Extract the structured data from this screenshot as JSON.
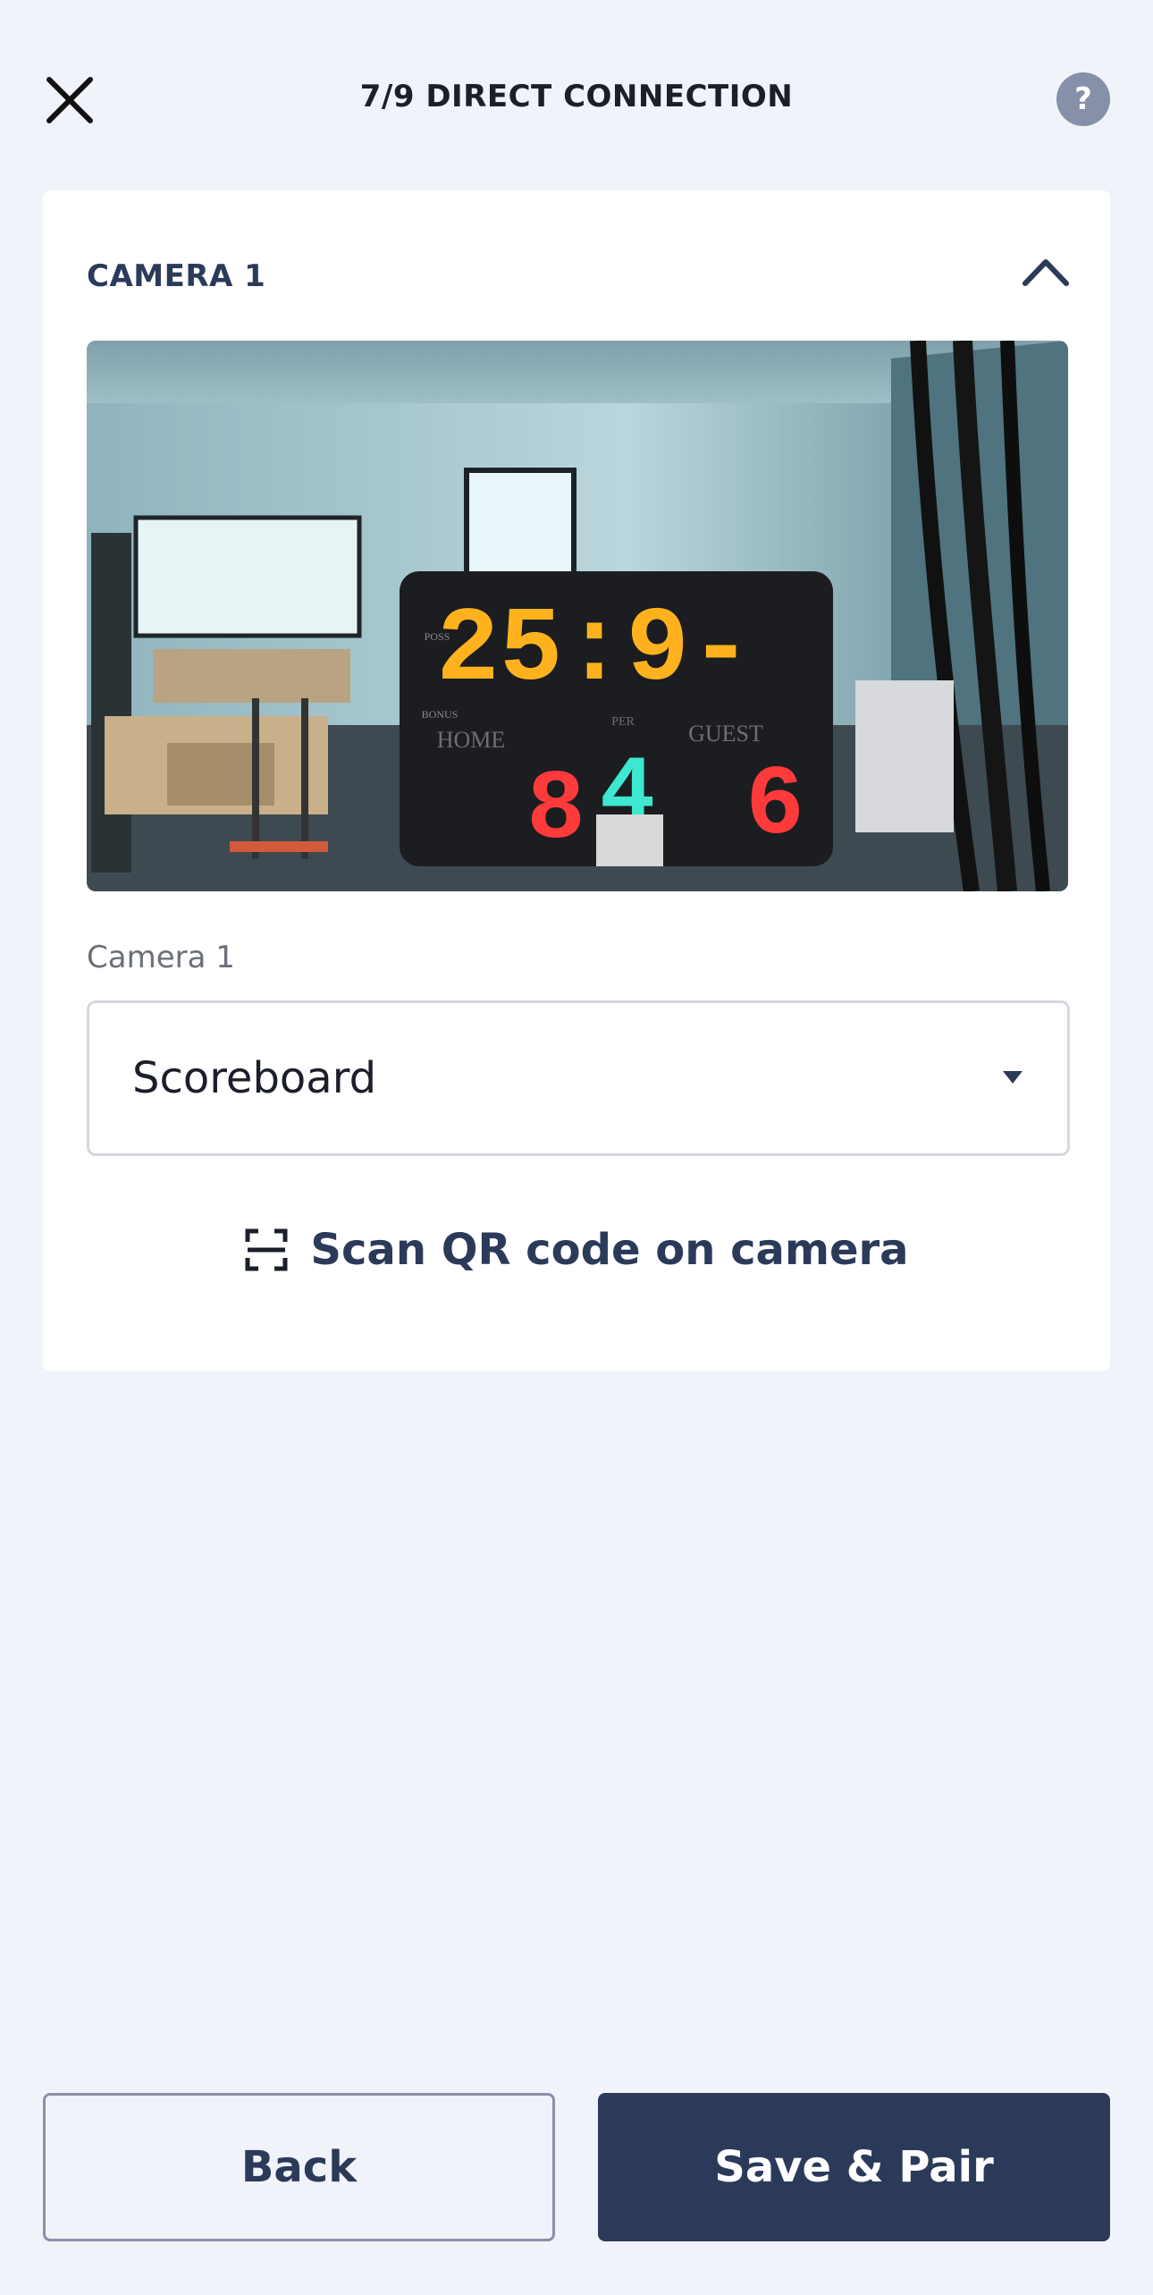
{
  "header": {
    "title": "7/9 DIRECT CONNECTION",
    "help_label": "?",
    "close_icon": "close-icon"
  },
  "camera_card": {
    "title": "CAMERA 1",
    "collapse_icon": "chevron-up-icon",
    "preview": {
      "scoreboard": {
        "clock": "25:9-",
        "period": "4",
        "home_score": "8",
        "guest_score": "6",
        "home_label": "HOME",
        "guest_label": "GUEST",
        "per_label": "PER",
        "poss_label": "POSS",
        "bonus_label": "BONUS"
      }
    },
    "field_label": "Camera 1",
    "select_value": "Scoreboard",
    "scan_label": "Scan QR code on camera",
    "scan_icon": "qr-scan-icon"
  },
  "footer": {
    "back_label": "Back",
    "save_label": "Save & Pair"
  },
  "colors": {
    "background": "#f0f3f9",
    "primary": "#2c3a5a",
    "help_circle": "#8690a8"
  }
}
